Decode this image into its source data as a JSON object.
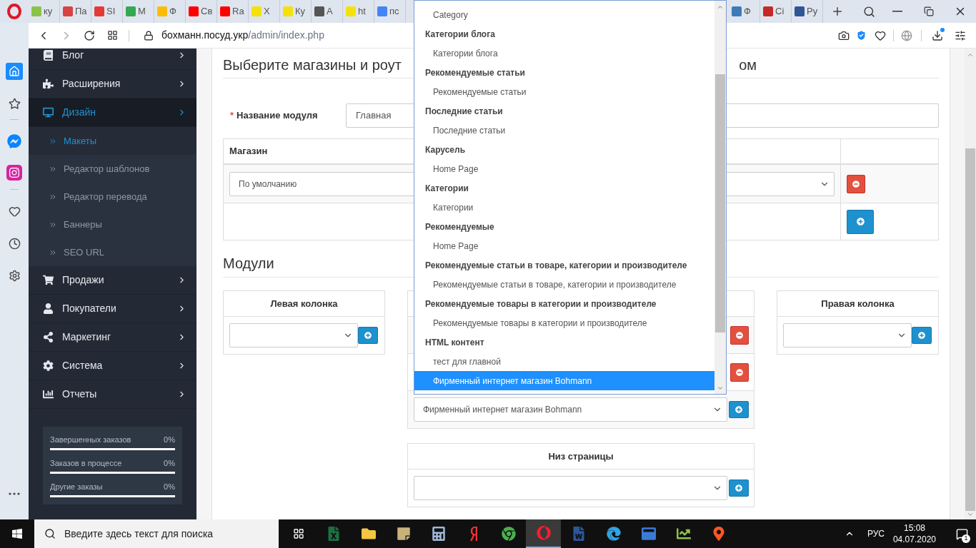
{
  "browser": {
    "tabs": [
      {
        "label": "ку",
        "color": "#8bc34a"
      },
      {
        "label": "Па",
        "color": "#d84343"
      },
      {
        "label": "SI",
        "color": "#e53935"
      },
      {
        "label": "M",
        "color": "#34a853"
      },
      {
        "label": "Ф",
        "color": "#fbbc05"
      },
      {
        "label": "Св",
        "color": "#ff0000"
      },
      {
        "label": "Ra",
        "color": "#ff0000"
      },
      {
        "label": "Х",
        "color": "#f5e10a"
      },
      {
        "label": "Ку",
        "color": "#f5e10a"
      },
      {
        "label": "А",
        "color": "#555555"
      },
      {
        "label": "ht",
        "color": "#f5e10a"
      },
      {
        "label": "пс",
        "color": "#4285f4"
      }
    ],
    "tabs_right": [
      {
        "label": "Ф",
        "color": "#3d7ab8"
      },
      {
        "label": "Ci",
        "color": "#c62828"
      },
      {
        "label": "Py",
        "color": "#2f5597"
      }
    ],
    "address": {
      "host": "бохманн.посуд.укр",
      "path": "/admin/index.php"
    }
  },
  "sidebar": {
    "items": [
      {
        "label": "Блог",
        "expanded": false
      },
      {
        "label": "Расширения",
        "expanded": false
      },
      {
        "label": "Дизайн",
        "expanded": true,
        "children": [
          {
            "label": "Макеты",
            "selected": true
          },
          {
            "label": "Редактор шаблонов",
            "selected": false
          },
          {
            "label": "Редактор перевода",
            "selected": false
          },
          {
            "label": "Баннеры",
            "selected": false
          },
          {
            "label": "SEO URL",
            "selected": false
          }
        ]
      },
      {
        "label": "Продажи",
        "expanded": false
      },
      {
        "label": "Покупатели",
        "expanded": false
      },
      {
        "label": "Маркетинг",
        "expanded": false
      },
      {
        "label": "Система",
        "expanded": false
      },
      {
        "label": "Отчеты",
        "expanded": false
      }
    ],
    "stats": [
      {
        "label": "Завершенных заказов",
        "value": "0%",
        "level": 0
      },
      {
        "label": "Заказов в процессе",
        "value": "0%",
        "level": 0
      },
      {
        "label": "Другие заказы",
        "value": "0%",
        "level": 0
      }
    ]
  },
  "main": {
    "heading_left": "Выберите магазины и роут",
    "heading_right": "ом",
    "module_name": {
      "required_mark": "*",
      "label": "Название модуля",
      "value": "Главная"
    },
    "store_table": {
      "columns": [
        "Магазин"
      ],
      "rows": [
        {
          "value": "По умолчанию"
        }
      ]
    },
    "modules_title": "Модули",
    "left": {
      "title": "Левая колонка"
    },
    "center": {
      "rows": [
        {
          "kind": "remove"
        },
        {
          "kind": "remove"
        },
        {
          "kind": "add",
          "value": "Фирменный интернет магазин Bohmann"
        }
      ]
    },
    "right": {
      "title": "Правая колонка"
    },
    "bottom": {
      "title": "Низ страницы"
    }
  },
  "dropdown": {
    "items": [
      {
        "kind": "option",
        "label": "Category",
        "selected": false
      },
      {
        "kind": "group",
        "label": "Категории блога"
      },
      {
        "kind": "option",
        "label": "Категории блога",
        "selected": false
      },
      {
        "kind": "group",
        "label": "Рекомендуемые статьи"
      },
      {
        "kind": "option",
        "label": "Рекомендуемые статьи",
        "selected": false
      },
      {
        "kind": "group",
        "label": "Последние статьи"
      },
      {
        "kind": "option",
        "label": "Последние статьи",
        "selected": false
      },
      {
        "kind": "group",
        "label": "Карусель"
      },
      {
        "kind": "option",
        "label": "Home Page",
        "selected": false
      },
      {
        "kind": "group",
        "label": "Категории"
      },
      {
        "kind": "option",
        "label": "Категории",
        "selected": false
      },
      {
        "kind": "group",
        "label": "Рекомендуемые"
      },
      {
        "kind": "option",
        "label": "Home Page",
        "selected": false
      },
      {
        "kind": "group",
        "label": "Рекомендуемые статьи в товаре, категории и производителе"
      },
      {
        "kind": "option",
        "label": "Рекомендуемые статьи в товаре, категории и производителе",
        "selected": false
      },
      {
        "kind": "group",
        "label": "Рекомендуемые товары в категории и производителе"
      },
      {
        "kind": "option",
        "label": "Рекомендуемые товары в категории и производителе",
        "selected": false
      },
      {
        "kind": "group",
        "label": "HTML контент"
      },
      {
        "kind": "option",
        "label": "тест для главной",
        "selected": false
      },
      {
        "kind": "option",
        "label": "Фирменный интернет магазин Bohmann",
        "selected": true
      }
    ]
  },
  "taskbar": {
    "search_placeholder": "Введите здесь текст для поиска",
    "apps": [
      {
        "selected": false
      },
      {
        "selected": false
      },
      {
        "selected": false
      },
      {
        "selected": false
      },
      {
        "selected": false
      },
      {
        "selected": false
      },
      {
        "selected": true
      },
      {
        "selected": false
      },
      {
        "selected": false
      },
      {
        "selected": false
      },
      {
        "selected": false
      },
      {
        "selected": false
      }
    ],
    "language": "РУС",
    "time": "15:08",
    "date": "04.07.2020",
    "notifications": "1"
  }
}
